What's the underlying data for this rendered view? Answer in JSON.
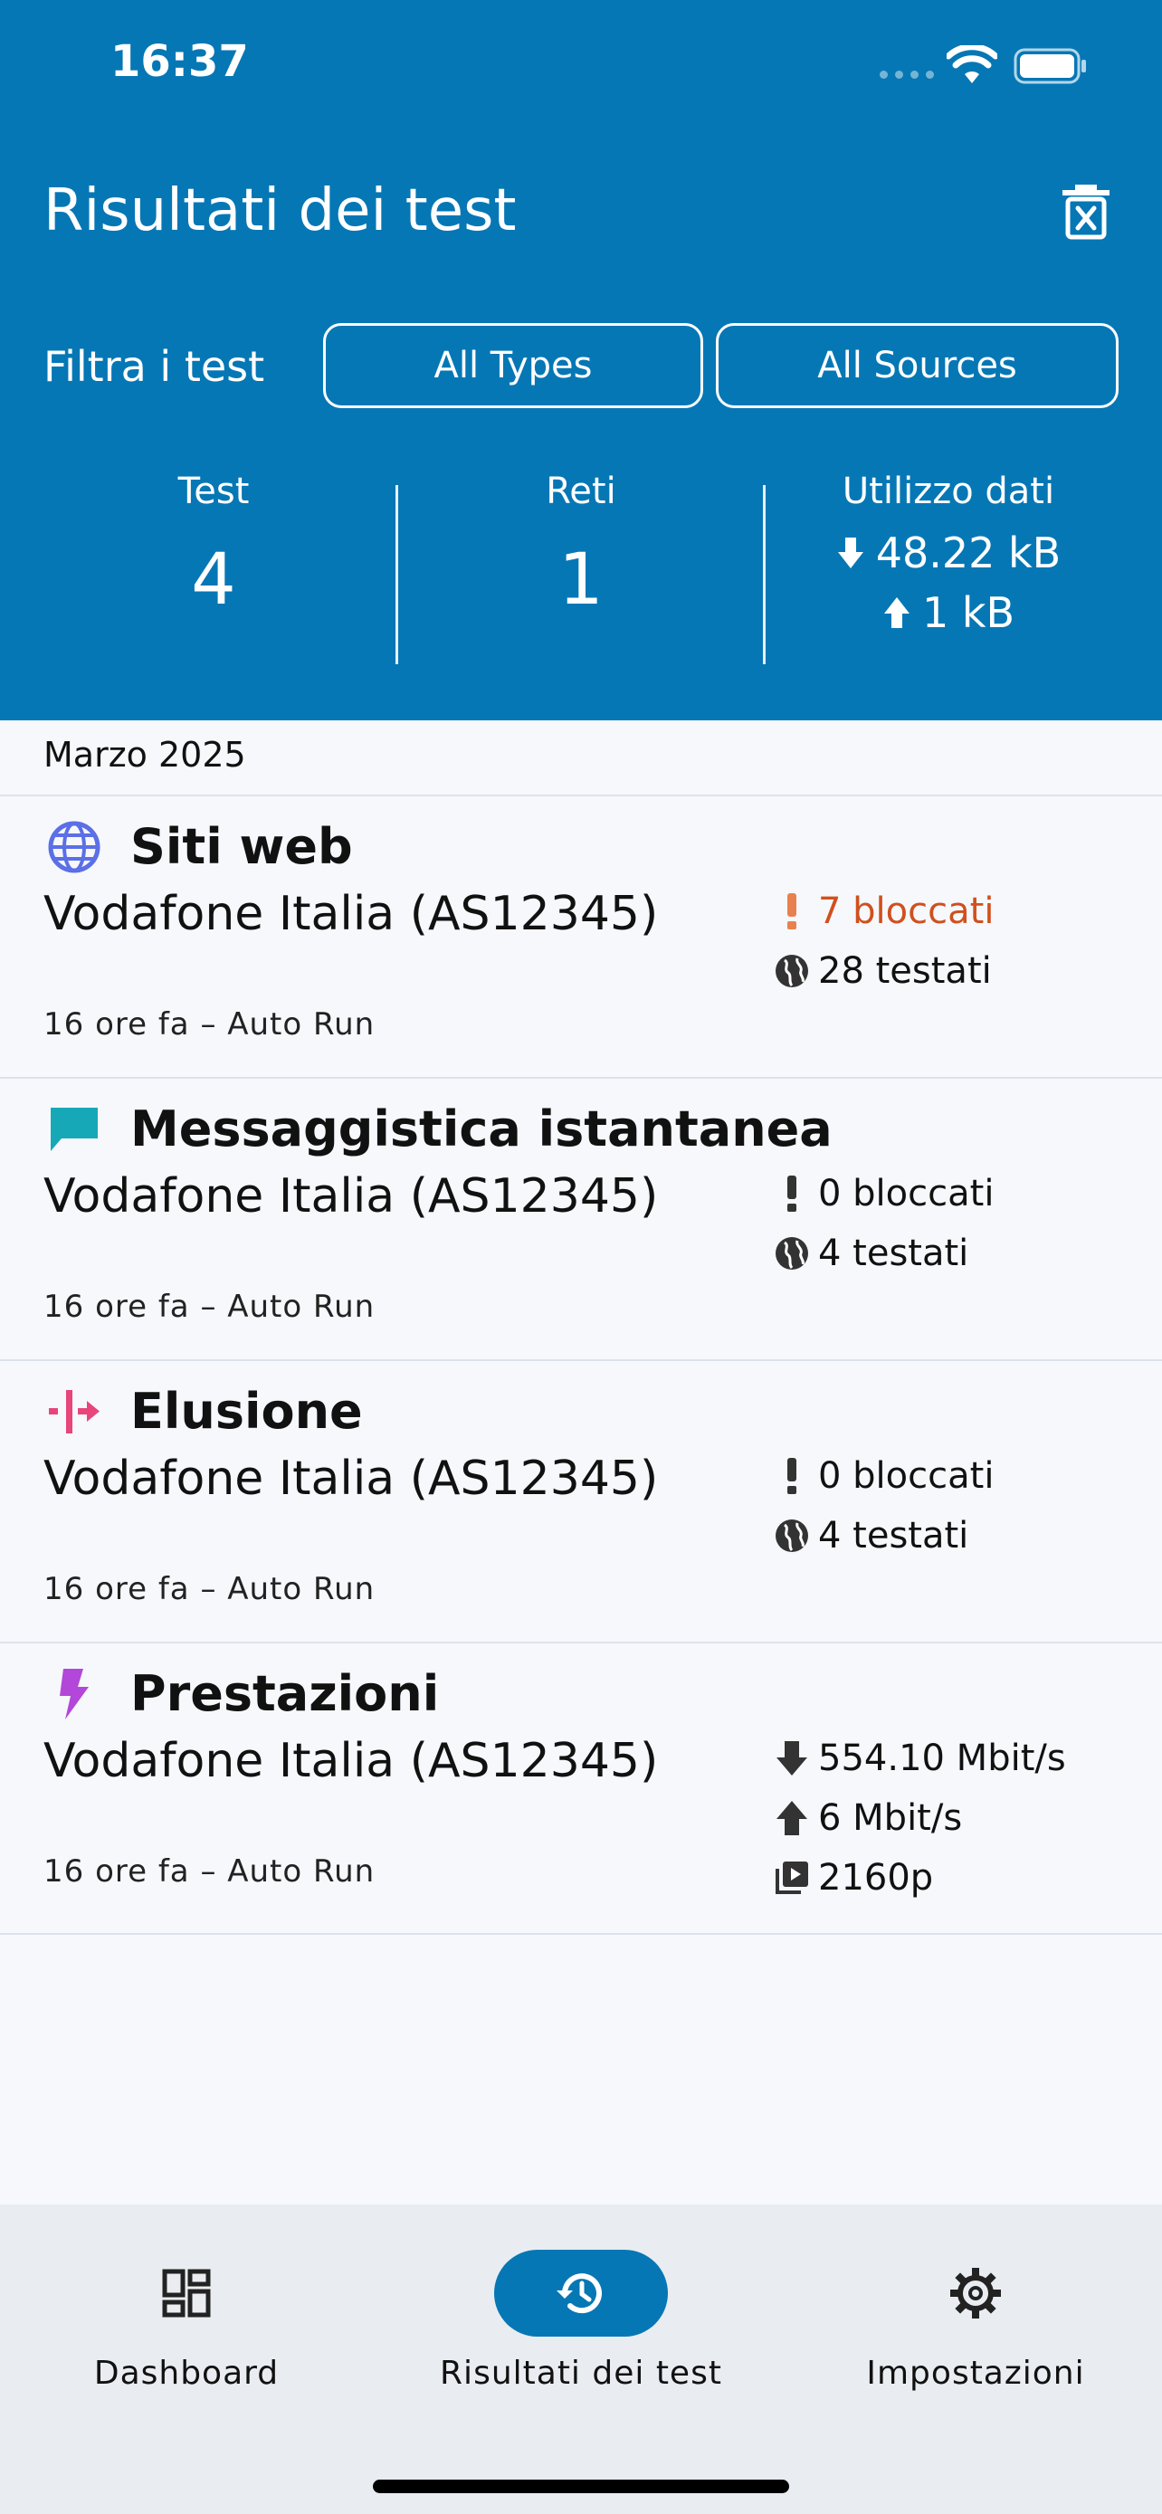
{
  "status_bar": {
    "time": "16:37"
  },
  "header": {
    "title": "Risultati dei test",
    "filter_label": "Filtra i test",
    "filter_types": "All Types",
    "filter_sources": "All Sources"
  },
  "stats": {
    "tests_label": "Test",
    "tests_value": "4",
    "networks_label": "Reti",
    "networks_value": "1",
    "data_label": "Utilizzo dati",
    "download": "48.22 kB",
    "upload": "1 kB"
  },
  "month": "Marzo 2025",
  "results": [
    {
      "title": "Siti web",
      "icon": "globe-icon",
      "color": "#5b6fe6",
      "network": "Vodafone Italia (AS12345)",
      "meta": "16 ore fa – Auto Run",
      "blocked": "7 bloccati",
      "tested": "28 testati"
    },
    {
      "title": "Messaggistica istantanea",
      "icon": "chat-icon",
      "color": "#17a8b8",
      "network": "Vodafone Italia (AS12345)",
      "meta": "16 ore fa – Auto Run",
      "blocked": "0 bloccati",
      "tested": "4 testati"
    },
    {
      "title": "Elusione",
      "icon": "circumvention-icon",
      "color": "#e8457a",
      "network": "Vodafone Italia (AS12345)",
      "meta": "16 ore fa – Auto Run",
      "blocked": "0 bloccati",
      "tested": "4 testati"
    },
    {
      "title": "Prestazioni",
      "icon": "lightning-icon",
      "color": "#b347d9",
      "network": "Vodafone Italia (AS12345)",
      "meta": "16 ore fa – Auto Run",
      "download": "554.10 Mbit/s",
      "upload": "6 Mbit/s",
      "video": "2160p"
    }
  ],
  "nav": {
    "dashboard": "Dashboard",
    "results": "Risultati dei test",
    "settings": "Impostazioni"
  },
  "colors": {
    "primary": "#0677b5",
    "blocked_alert": "#d0501e"
  }
}
